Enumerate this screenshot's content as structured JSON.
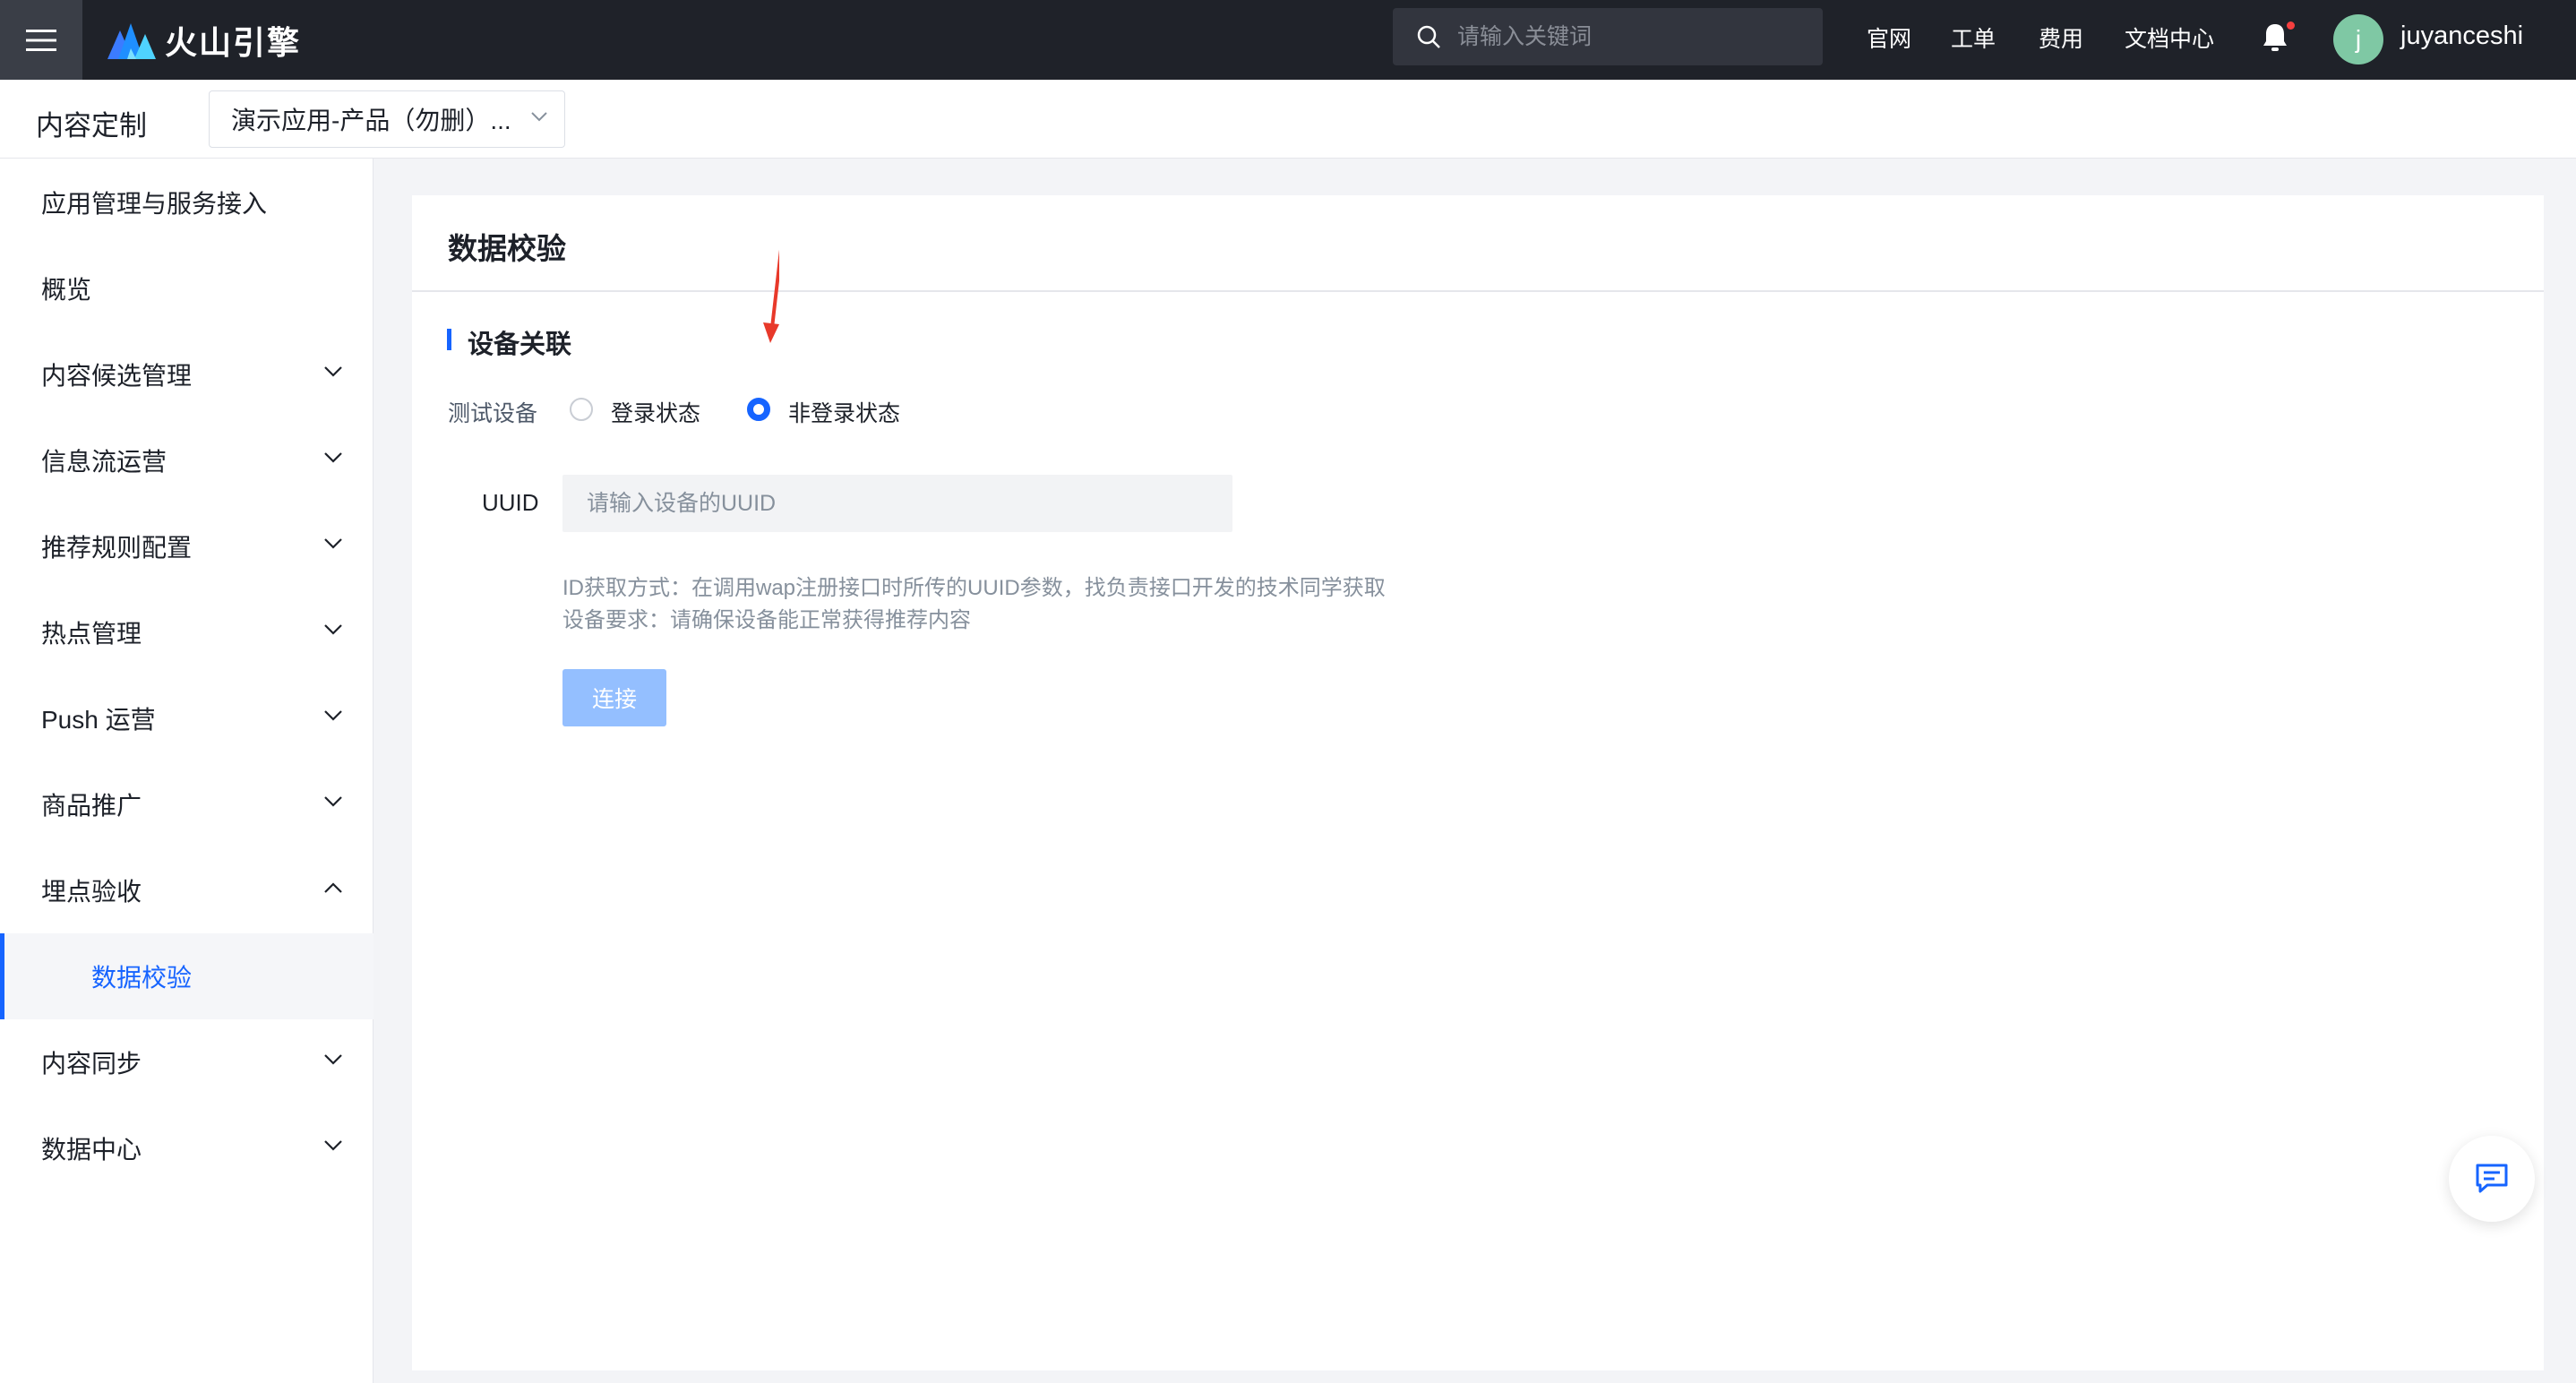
{
  "topbar": {
    "brand": "火山引擎",
    "search_placeholder": "请输入关键词",
    "links": [
      "官网",
      "工单",
      "费用",
      "文档中心"
    ],
    "avatar_initial": "j",
    "username": "juyanceshi",
    "notification_dot": true
  },
  "subheader": {
    "title": "内容定制",
    "app_select_value": "演示应用-产品（勿删）..."
  },
  "sidebar": {
    "items": [
      {
        "label": "应用管理与服务接入",
        "chevron": "none"
      },
      {
        "label": "概览",
        "chevron": "none"
      },
      {
        "label": "内容候选管理",
        "chevron": "down"
      },
      {
        "label": "信息流运营",
        "chevron": "down"
      },
      {
        "label": "推荐规则配置",
        "chevron": "down"
      },
      {
        "label": "热点管理",
        "chevron": "down"
      },
      {
        "label": "Push 运营",
        "chevron": "down"
      },
      {
        "label": "商品推广",
        "chevron": "down"
      },
      {
        "label": "埋点验收",
        "chevron": "up"
      },
      {
        "label": "数据校验",
        "chevron": "none",
        "active": true
      },
      {
        "label": "内容同步",
        "chevron": "down"
      },
      {
        "label": "数据中心",
        "chevron": "down"
      }
    ]
  },
  "main": {
    "title": "数据校验",
    "section_title": "设备关联",
    "test_device_label": "测试设备",
    "radio_options": [
      {
        "label": "登录状态",
        "checked": false
      },
      {
        "label": "非登录状态",
        "checked": true
      }
    ],
    "uuid_label": "UUID",
    "uuid_placeholder": "请输入设备的UUID",
    "hint_lines": [
      "ID获取方式：在调用wap注册接口时所传的UUID参数，找负责接口开发的技术同学获取",
      "设备要求：请确保设备能正常获得推荐内容"
    ],
    "connect_label": "连接"
  },
  "colors": {
    "accent": "#1664ff",
    "topbar_bg": "#1f2229",
    "button_disabled": "#94bfff",
    "annotation_arrow": "#e8392a"
  }
}
